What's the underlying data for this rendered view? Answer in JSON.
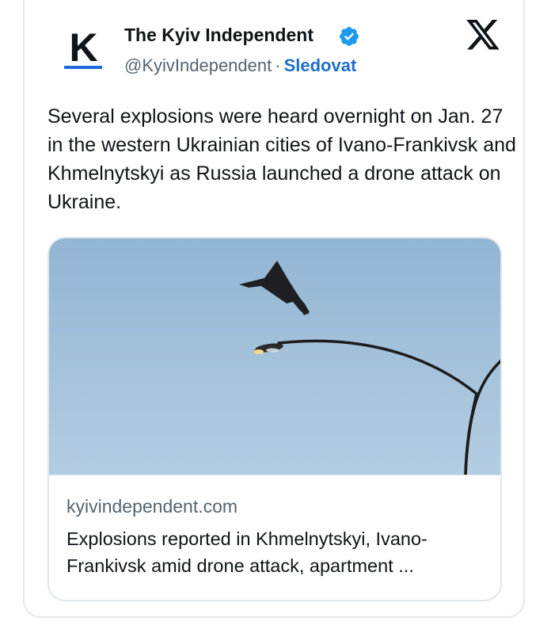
{
  "tweet": {
    "author_name": "The Kyiv Independent",
    "handle": "@KyivIndependent",
    "separator": "·",
    "follow_label": "Sledovat",
    "avatar_letter": "K",
    "text": "Several explosions were heard overnight on Jan. 27 in the western Ukrainian cities of Ivano-Frankivsk and Khmelnytskyi as Russia launched a drone attack on Ukraine."
  },
  "link_card": {
    "domain": "kyivindependent.com",
    "title": "Explosions reported in Khmelnytskyi, Ivano-Frankivsk amid drone attack, apartment ...",
    "image_icon": "drone-and-streetlight-photo"
  },
  "icons": {
    "verified": "verified-badge-icon",
    "platform": "x-logo-icon"
  },
  "colors": {
    "link_blue": "#1d6fc7",
    "verified_blue": "#1d9bf0",
    "avatar_accent": "#1d6ae0",
    "secondary_text": "#536471",
    "primary_text": "#0f1419",
    "sky": "#9cbdd8"
  }
}
